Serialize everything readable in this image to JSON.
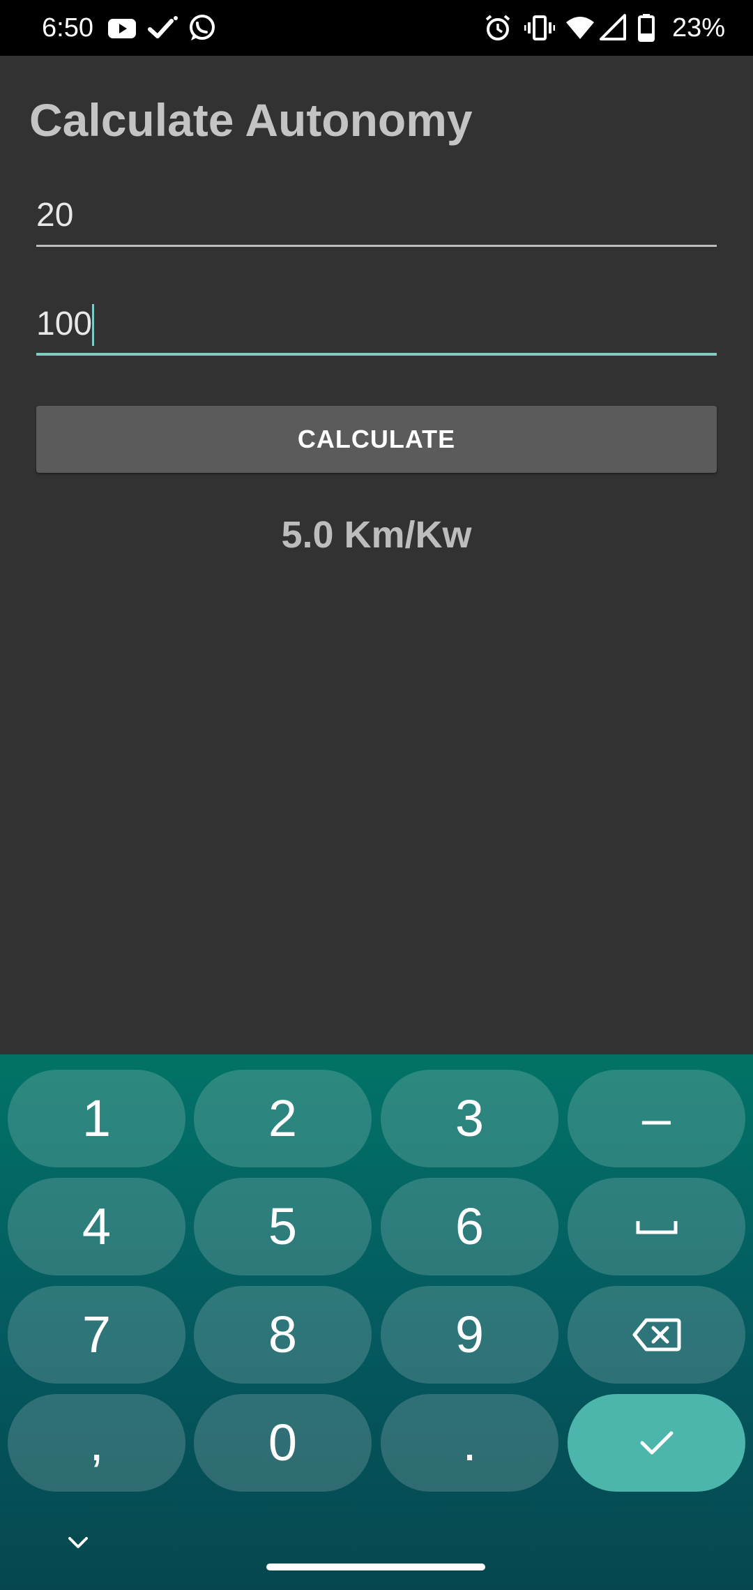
{
  "status_bar": {
    "time": "6:50",
    "notification_icons": [
      "youtube-icon",
      "check-icon",
      "whatsapp-icon"
    ],
    "system_icons": [
      "alarm-icon",
      "vibrate-icon",
      "wifi-icon",
      "cell-signal-icon",
      "battery-icon"
    ],
    "battery_percent": "23%"
  },
  "screen": {
    "title": "Calculate Autonomy",
    "field_1_value": "20",
    "field_2_value": "100",
    "calculate_label": "CALCULATE",
    "result_text": "5.0 Km/Kw"
  },
  "keyboard": {
    "rows": [
      [
        "1",
        "2",
        "3",
        "-"
      ],
      [
        "4",
        "5",
        "6",
        "space-icon"
      ],
      [
        "7",
        "8",
        "9",
        "backspace-icon"
      ],
      [
        ",",
        "0",
        ".",
        "check-icon"
      ]
    ],
    "key_1": "1",
    "key_2": "2",
    "key_3": "3",
    "key_minus": "–",
    "key_4": "4",
    "key_5": "5",
    "key_6": "6",
    "key_7": "7",
    "key_8": "8",
    "key_9": "9",
    "key_comma": ",",
    "key_0": "0",
    "key_period": "."
  },
  "colors": {
    "background": "#323232",
    "accent": "#80cbc4",
    "keyboard_top": "#027367",
    "keyboard_done": "#4db6ac"
  }
}
